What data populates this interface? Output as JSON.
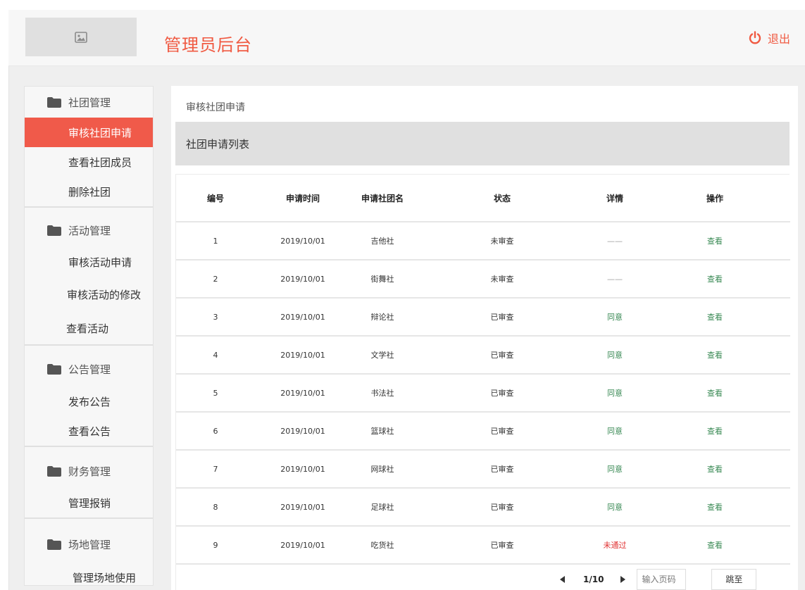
{
  "header": {
    "title": "管理员后台",
    "logout_label": "退出",
    "accent_color": "#f05a42"
  },
  "sidebar": {
    "groups": [
      {
        "label": "社团管理",
        "items": [
          "审核社团申请",
          "查看社团成员",
          "删除社团"
        ]
      },
      {
        "label": "活动管理",
        "items": [
          "审核活动申请",
          "审核活动的修改",
          "查看活动"
        ]
      },
      {
        "label": "公告管理",
        "items": [
          "发布公告",
          "查看公告"
        ]
      },
      {
        "label": "财务管理",
        "items": [
          "管理报销"
        ]
      },
      {
        "label": "场地管理",
        "items": [
          "管理场地使用"
        ]
      }
    ],
    "active_item": "审核社团申请"
  },
  "content": {
    "breadcrumb": "审核社团申请",
    "list_title": "社团申请列表",
    "columns": [
      "编号",
      "申请时间",
      "申请社团名",
      "状态",
      "详情",
      "操作"
    ],
    "rows": [
      {
        "id": "1",
        "time": "2019/10/01",
        "name": "吉他社",
        "status": "未审查",
        "detail": "——",
        "action": "查看"
      },
      {
        "id": "2",
        "time": "2019/10/01",
        "name": "街舞社",
        "status": "未审查",
        "detail": "——",
        "action": "查看"
      },
      {
        "id": "3",
        "time": "2019/10/01",
        "name": "辩论社",
        "status": "已审查",
        "detail": "同意",
        "action": "查看"
      },
      {
        "id": "4",
        "time": "2019/10/01",
        "name": "文学社",
        "status": "已审查",
        "detail": "同意",
        "action": "查看"
      },
      {
        "id": "5",
        "time": "2019/10/01",
        "name": "书法社",
        "status": "已审查",
        "detail": "同意",
        "action": "查看"
      },
      {
        "id": "6",
        "time": "2019/10/01",
        "name": "篮球社",
        "status": "已审查",
        "detail": "同意",
        "action": "查看"
      },
      {
        "id": "7",
        "time": "2019/10/01",
        "name": "网球社",
        "status": "已审查",
        "detail": "同意",
        "action": "查看"
      },
      {
        "id": "8",
        "time": "2019/10/01",
        "name": "足球社",
        "status": "已审查",
        "detail": "同意",
        "action": "查看"
      },
      {
        "id": "9",
        "time": "2019/10/01",
        "name": "吃货社",
        "status": "已审查",
        "detail": "未通过",
        "action": "查看"
      }
    ],
    "pager": {
      "page_info": "1/10",
      "input_placeholder": "输入页码",
      "jump_label": "跳至"
    }
  }
}
